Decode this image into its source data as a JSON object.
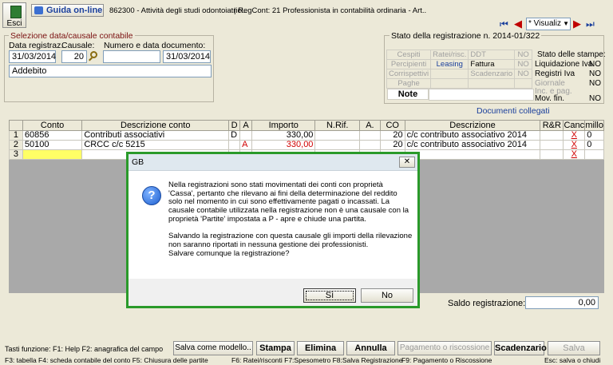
{
  "toolbar": {
    "esci_label": "Esci",
    "guide_label": "Guida on-line",
    "activity_text": "862300 - Attività degli studi odontoiatrici..",
    "regime_text": "| RegCont: 21 Professionista in contabilità ordinaria - Art..",
    "visual_select": "* Visualiz"
  },
  "selection": {
    "title": "Selezione data/causale contabile",
    "date_label": "Data registraz.",
    "cause_label": "Causale:",
    "doc_label": "Numero e data documento:",
    "date_value": "31/03/2014",
    "cause_value": "20",
    "doc_number": "",
    "doc_date": "31/03/2014",
    "description": "Addebito"
  },
  "status": {
    "title": "Stato della registrazione n. 2014-01/322",
    "rows": [
      [
        "Cespiti",
        "Ratei/risc.",
        "DDT",
        "NO"
      ],
      [
        "Percipienti",
        "Leasing",
        "Fattura",
        "NO"
      ],
      [
        "Corrispettivi",
        "",
        "Scadenzario",
        "NO"
      ],
      [
        "Paghe",
        "",
        "",
        ""
      ]
    ],
    "note_label": "Note",
    "print_title": "Stato delle stampe:",
    "prints": [
      [
        "Liquidazione Iva",
        "NO"
      ],
      [
        "Registri Iva",
        "NO"
      ],
      [
        "Giornale",
        "NO"
      ],
      [
        "Inc. e pag.",
        ""
      ],
      [
        "Mov. fin.",
        "NO"
      ]
    ],
    "documents_link": "Documenti collegati"
  },
  "grid": {
    "headers": [
      "Conto",
      "Descrizione conto",
      "D",
      "A",
      "Importo",
      "N.Rif.",
      "A.",
      "CO",
      "Descrizione",
      "R&R",
      "Canc",
      "millo"
    ],
    "rows": [
      {
        "num": "1",
        "conto": "60856",
        "descr": "Contributi associativi",
        "d": "D",
        "a": "",
        "importo": "330,00",
        "nrif": "",
        "aa": "",
        "co": "20",
        "descrizione": "c/c contributo associativo 2014",
        "rr": "",
        "canc": "X",
        "millo": "0"
      },
      {
        "num": "2",
        "conto": "50100",
        "descr": "CRCC c/c 5215",
        "d": "",
        "a": "A",
        "importo": "330,00",
        "nrif": "",
        "aa": "",
        "co": "20",
        "descrizione": "c/c contributo associativo 2014",
        "rr": "",
        "canc": "X",
        "millo": "0"
      },
      {
        "num": "3",
        "conto": "",
        "descr": "",
        "d": "",
        "a": "",
        "importo": "",
        "nrif": "",
        "aa": "",
        "co": "",
        "descrizione": "",
        "rr": "",
        "canc": "X",
        "millo": ""
      }
    ]
  },
  "saldo": {
    "label": "Saldo registrazione:",
    "value": "0,00"
  },
  "dialog": {
    "title": "GB",
    "message_lines": [
      "Nella registrazioni sono stati movimentati dei conti con proprietà",
      "'Cassa', pertanto che rilevano ai fini della determinazione del reddito",
      "solo nel momento in cui sono effettivamente pagati o incassati. La",
      "causale contabile utilizzata nella registrazione non è una causale con la",
      "proprietà 'Partite' impostata a P - apre e chiude una partita.",
      "",
      "Salvando la registrazione con questa causale gli importi della rilevazione",
      "non saranno riportati in nessuna gestione dei professionisti.",
      "Salvare comunque la registrazione?"
    ],
    "yes_label": "Sì",
    "no_label": "No"
  },
  "footer": {
    "keys_line1": "Tasti funzione:  F1: Help  F2: anagrafica del campo",
    "keys_line2a": "F3: tabella   F4: scheda contabile del conto   F5: Chiusura delle partite",
    "keys_line2b": "F6: Ratei/risconti   F7:Spesometro   F8:Salva Registrazione",
    "keys_line2c": "F9: Pagamento o Riscossione",
    "keys_line2d": "Esc: salva o chiudi",
    "buttons": {
      "salva_modello": "Salva come modello..",
      "stampa": "Stampa",
      "elimina": "Elimina",
      "annulla": "Annulla",
      "pagamento": "Pagamento o riscossione",
      "scadenzario": "Scadenzario",
      "salva": "Salva"
    }
  }
}
